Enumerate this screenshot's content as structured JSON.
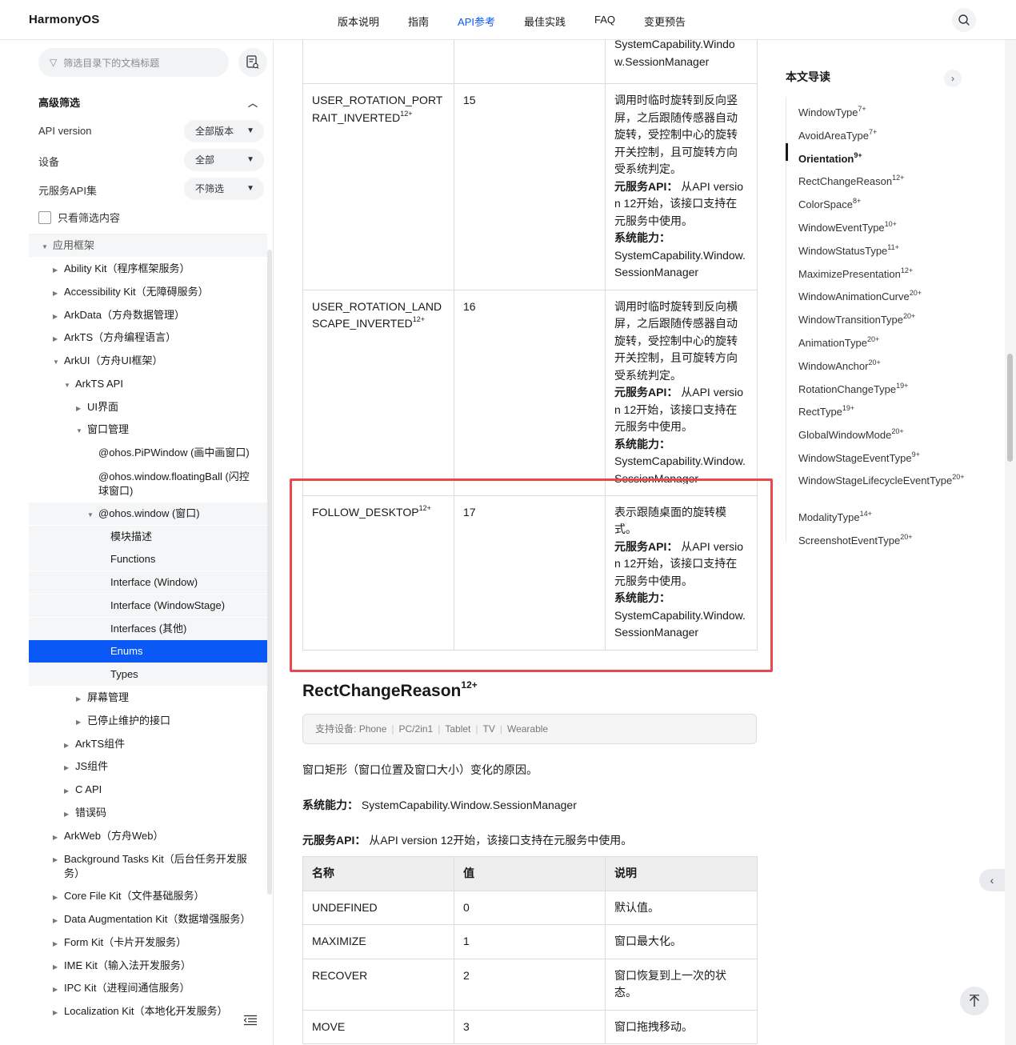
{
  "header": {
    "logo": "HarmonyOS",
    "nav": [
      {
        "label": "版本说明",
        "active": false
      },
      {
        "label": "指南",
        "active": false
      },
      {
        "label": "API参考",
        "active": true
      },
      {
        "label": "最佳实践",
        "active": false
      },
      {
        "label": "FAQ",
        "active": false
      },
      {
        "label": "变更预告",
        "active": false
      }
    ],
    "search_icon": "search-icon"
  },
  "sidebar": {
    "filter_placeholder": "筛选目录下的文档标题",
    "advanced": {
      "title": "高级筛选",
      "api_version_label": "API version",
      "api_version_value": "全部版本",
      "device_label": "设备",
      "device_value": "全部",
      "meta_label": "元服务API集",
      "meta_value": "不筛选",
      "only_filtered_label": "只看筛选内容"
    },
    "tree": [
      "应用框架",
      "Ability Kit（程序框架服务）",
      "Accessibility Kit（无障碍服务）",
      "ArkData（方舟数据管理）",
      "ArkTS（方舟编程语言）",
      "ArkUI（方舟UI框架）",
      "ArkTS API",
      "UI界面",
      "窗口管理",
      "@ohos.PiPWindow (画中画窗口)",
      "@ohos.window.floatingBall (闪控球窗口)",
      "@ohos.window (窗口)",
      "模块描述",
      "Functions",
      "Interface (Window)",
      "Interface (WindowStage)",
      "Interfaces (其他)",
      "Enums",
      "Types",
      "屏幕管理",
      "已停止维护的接口",
      "ArkTS组件",
      "JS组件",
      "C API",
      "错误码",
      "ArkWeb（方舟Web）",
      "Background Tasks Kit（后台任务开发服务）",
      "Core File Kit（文件基础服务）",
      "Data Augmentation Kit（数据增强服务）",
      "Form Kit（卡片开发服务）",
      "IME Kit（输入法开发服务）",
      "IPC Kit（进程间通信服务）",
      "Localization Kit（本地化开发服务）"
    ]
  },
  "orientation_table": {
    "rows": [
      {
        "name": "",
        "name_sup": "",
        "value": "",
        "desc_lines": [
          "SystemCapability.Windo",
          "w.SessionManager"
        ]
      },
      {
        "name": "USER_ROTATION_PORTRAIT_INVERTED",
        "name_sup": "12+",
        "value": "15",
        "desc": "调用时临时旋转到反向竖屏，之后跟随传感器自动旋转，受控制中心的旋转开关控制，且可旋转方向受系统判定。",
        "meta_label": "元服务API：",
        "meta_text": "从API version 12开始，该接口支持在元服务中使用。",
        "sys_label": "系统能力：",
        "sys_text": "SystemCapability.Window.SessionManager"
      },
      {
        "name": "USER_ROTATION_LANDSCAPE_INVERTED",
        "name_sup": "12+",
        "value": "16",
        "desc": "调用时临时旋转到反向横屏，之后跟随传感器自动旋转，受控制中心的旋转开关控制，且可旋转方向受系统判定。",
        "meta_label": "元服务API：",
        "meta_text": "从API version 12开始，该接口支持在元服务中使用。",
        "sys_label": "系统能力：",
        "sys_text": "SystemCapability.Window.SessionManager"
      },
      {
        "name": "FOLLOW_DESKTOP",
        "name_sup": "12+",
        "value": "17",
        "desc": "表示跟随桌面的旋转模式。",
        "meta_label": "元服务API：",
        "meta_text": "从API version 12开始，该接口支持在元服务中使用。",
        "sys_label": "系统能力：",
        "sys_text": "SystemCapability.Window.SessionManager"
      }
    ]
  },
  "section": {
    "title": "RectChangeReason",
    "title_sup": "12+",
    "devices_label": "支持设备:",
    "devices": [
      "Phone",
      "PC/2in1",
      "Tablet",
      "TV",
      "Wearable"
    ],
    "intro": "窗口矩形（窗口位置及窗口大小）变化的原因。",
    "sys_label": "系统能力：",
    "sys_text": "SystemCapability.Window.SessionManager",
    "meta_label": "元服务API：",
    "meta_text": "从API version 12开始，该接口支持在元服务中使用。",
    "table_headers": [
      "名称",
      "值",
      "说明"
    ],
    "table_rows": [
      {
        "name": "UNDEFINED",
        "value": "0",
        "desc": "默认值。"
      },
      {
        "name": "MAXIMIZE",
        "value": "1",
        "desc": "窗口最大化。"
      },
      {
        "name": "RECOVER",
        "value": "2",
        "desc": "窗口恢复到上一次的状态。"
      },
      {
        "name": "MOVE",
        "value": "3",
        "desc": "窗口拖拽移动。"
      }
    ]
  },
  "toc": {
    "title": "本文导读",
    "items": [
      {
        "label": "WindowType",
        "sup": "7+"
      },
      {
        "label": "AvoidAreaType",
        "sup": "7+"
      },
      {
        "label": "Orientation",
        "sup": "9+"
      },
      {
        "label": "RectChangeReason",
        "sup": "12+"
      },
      {
        "label": "ColorSpace",
        "sup": "8+"
      },
      {
        "label": "WindowEventType",
        "sup": "10+"
      },
      {
        "label": "WindowStatusType",
        "sup": "11+"
      },
      {
        "label": "MaximizePresentation",
        "sup": "12+"
      },
      {
        "label": "WindowAnimationCurve",
        "sup": "20+"
      },
      {
        "label": "WindowTransitionType",
        "sup": "20+"
      },
      {
        "label": "AnimationType",
        "sup": "20+"
      },
      {
        "label": "WindowAnchor",
        "sup": "20+"
      },
      {
        "label": "RotationChangeType",
        "sup": "19+"
      },
      {
        "label": "RectType",
        "sup": "19+"
      },
      {
        "label": "GlobalWindowMode",
        "sup": "20+"
      },
      {
        "label": "WindowStageEventType",
        "sup": "9+"
      },
      {
        "label": "WindowStageLifecycleEventType",
        "sup": "20+"
      },
      {
        "label": "ModalityType",
        "sup": "14+"
      },
      {
        "label": "ScreenshotEventType",
        "sup": "20+"
      }
    ]
  },
  "colors": {
    "accent": "#0a59f7",
    "highlight_border": "#e8494f",
    "table_header_bg": "#eeeeee"
  }
}
